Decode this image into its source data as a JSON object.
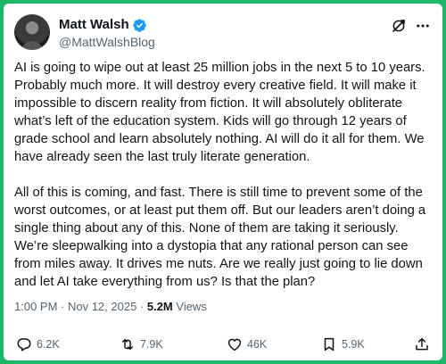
{
  "author": {
    "display_name": "Matt Walsh",
    "handle": "@MattWalshBlog",
    "verified": true
  },
  "icons": {
    "verified": "verified-badge-icon",
    "grok": "grok-icon",
    "more": "more-icon",
    "reply": "reply-icon",
    "repost": "repost-icon",
    "like": "like-icon",
    "bookmark": "bookmark-icon",
    "share": "share-icon"
  },
  "colors": {
    "background": "#1fb86a",
    "verified": "#1d9bf0",
    "secondary_text": "#536471",
    "primary_text": "#0f1419"
  },
  "tweet": {
    "paragraphs": [
      "AI is going to wipe out at least 25 million jobs in the next 5 to 10 years. Probably much more. It will destroy every creative field. It will make it impossible to discern reality from fiction. It will absolutely obliterate what’s left of the education system. Kids will go through 12 years of grade school and learn absolutely nothing. AI will do it all for them. We have already seen the last truly literate generation.",
      "All of this is coming, and fast. There is still time to prevent some of the worst outcomes, or at least put them off. But our leaders aren’t doing a single thing about any of this. None of them are taking it seriously. We’re sleepwalking into a dystopia that any rational person can see from miles away. It drives me nuts. Are we really just going to lie down and let AI take everything from us? Is that the plan?"
    ],
    "timestamp": "1:00 PM · Nov 12, 2025 · ",
    "views_count": "5.2M",
    "views_label": " Views"
  },
  "actions": {
    "replies": "6.2K",
    "reposts": "7.9K",
    "likes": "46K",
    "bookmarks": "5.9K"
  }
}
